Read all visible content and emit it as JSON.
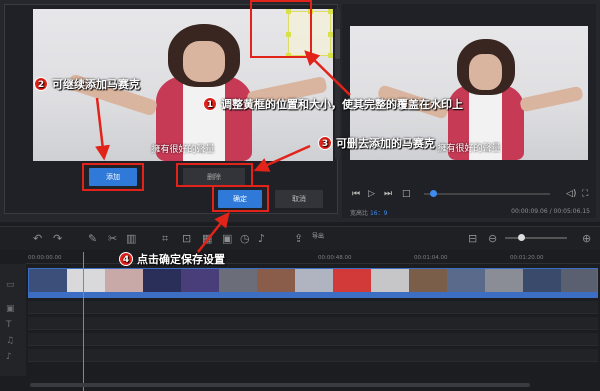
{
  "editor": {
    "subtitle": "擁有很好的聲量",
    "add_label": "添加",
    "delete_label": "删除",
    "ok_label": "确定",
    "cancel_label": "取消"
  },
  "preview": {
    "subtitle": "擁有很好的聲量",
    "aspect_label": "宽高比",
    "aspect_value": "16：9",
    "timecode": "00:00:09.06 / 00:05:06.15"
  },
  "toolbar": {
    "export_label": "导出"
  },
  "ruler": {
    "ticks": [
      "00:00:00.00",
      "00:00:48.00",
      "00:01:04.00",
      "00:01:20.00"
    ]
  },
  "annotations": {
    "n1": "1",
    "t1": "调整黄框的位置和大小，使其完整的覆盖在水印上",
    "n2": "2",
    "t2": "可继续添加马赛克",
    "n3": "3",
    "t3": "可删去添加的马赛克",
    "n4": "4",
    "t4": "点击确定保存设置"
  },
  "colors": {
    "accent": "#2f79d9",
    "annotation_red": "#e2231a",
    "mosaic_border": "#dddd66",
    "background": "#1c1d21"
  },
  "icons": [
    "undo-icon",
    "redo-icon",
    "pen-icon",
    "scissors-icon",
    "delete-icon",
    "crop-icon",
    "fit-icon",
    "mosaic-icon",
    "timer-icon",
    "mic-icon",
    "export-icon",
    "zoom-in-icon",
    "zoom-out-icon",
    "fit-timeline-icon"
  ]
}
